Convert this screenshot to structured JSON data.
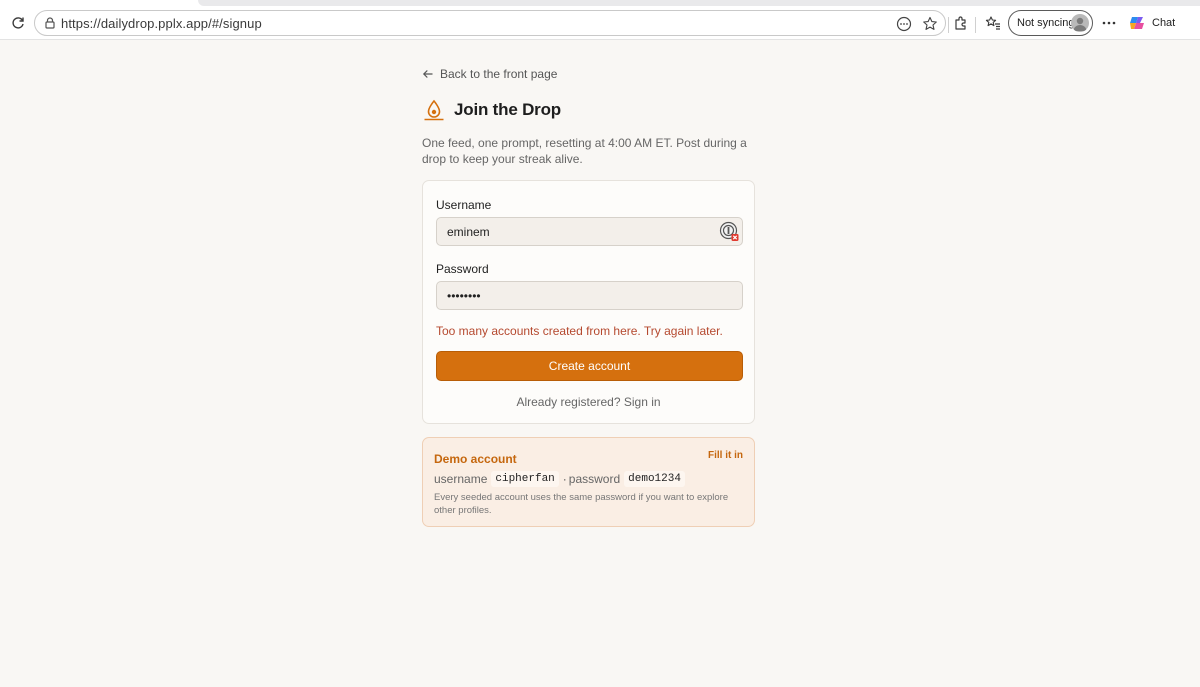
{
  "browser": {
    "url": "https://dailydrop.pplx.app/#/signup",
    "sync_label": "Not syncing",
    "chat_label": "Chat"
  },
  "page": {
    "back_link": "Back to the front page",
    "title": "Join the Drop",
    "intro": "One feed, one prompt, resetting at 4:00 AM ET. Post during a drop to keep your streak alive."
  },
  "form": {
    "username_label": "Username",
    "username_value": "eminem",
    "password_label": "Password",
    "password_value": "••••••••",
    "error": "Too many accounts created from here. Try again later.",
    "submit_label": "Create account",
    "signin_link": "Already registered? Sign in"
  },
  "demo": {
    "title": "Demo account",
    "fill_label": "Fill it in",
    "username_label": "username",
    "username_value": "cipherfan",
    "separator": "·",
    "password_label": "password",
    "password_value": "demo1234",
    "note": "Every seeded account uses the same password if you want to explore other profiles."
  },
  "colors": {
    "accent": "#d5700e",
    "error": "#b5492f",
    "page_bg": "#f9f7f4",
    "demo_bg": "#faeee4"
  },
  "icons": {
    "reload": "reload-icon",
    "lock": "site-info-icon",
    "reader": "reader-mode-icon",
    "favorite": "favorite-star-icon",
    "extensions": "extensions-icon",
    "favorites": "favorites-list-icon",
    "more": "more-icon",
    "copilot": "copilot-icon",
    "back": "arrow-left-icon",
    "logo": "drop-logo-icon",
    "password_manager": "password-manager-icon"
  }
}
